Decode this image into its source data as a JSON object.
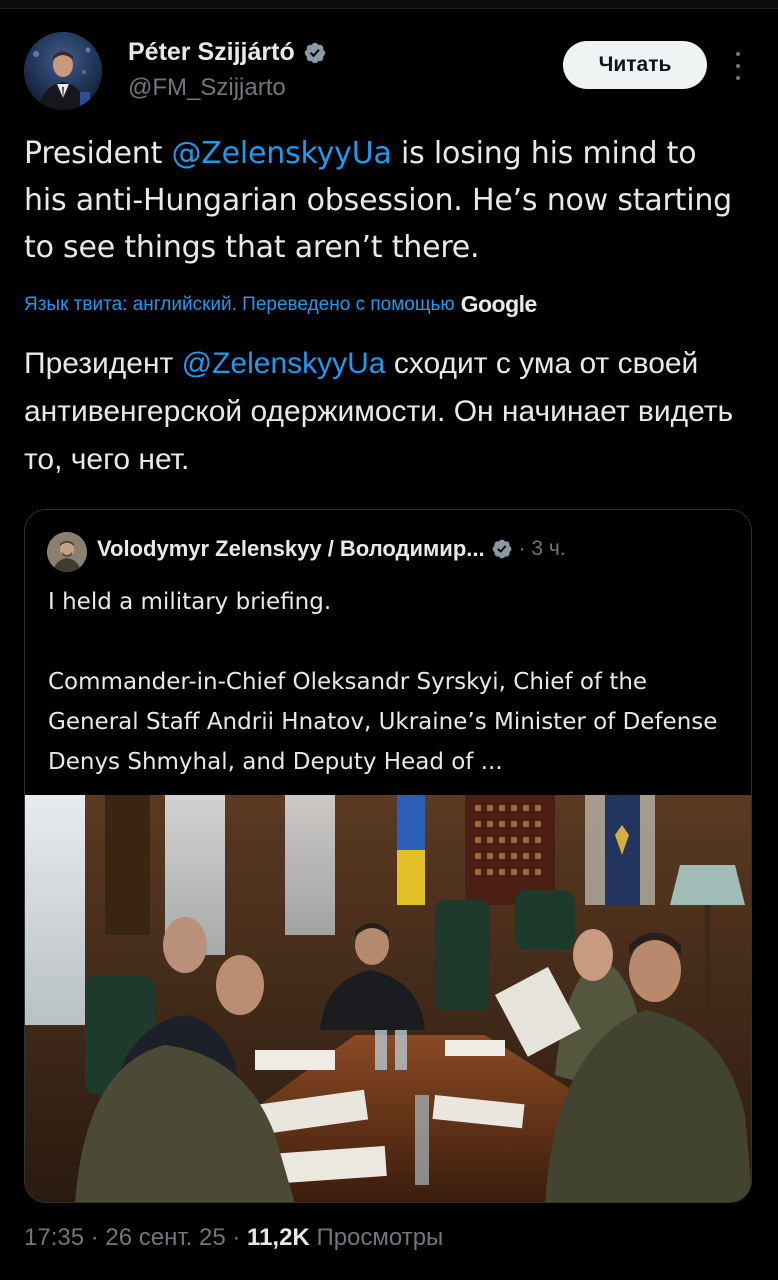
{
  "tweet": {
    "author": {
      "name": "Péter Szijjártó",
      "handle": "@FM_Szijjarto",
      "verified": true
    },
    "read_button_label": "Читать",
    "text": {
      "part1": "President ",
      "mention": "@ZelenskyyUa",
      "part2": " is losing his mind to his anti-Hungarian obsession. He’s now starting to see things that aren’t there."
    },
    "translation_note": "Язык твита: английский. Переведено с помощью",
    "translation_provider": "Google",
    "translated_text": {
      "part1": "Президент ",
      "mention": "@ZelenskyyUa",
      "part2": " сходит с ума от своей антивенгерской одержимости. Он начинает видеть то, чего нет."
    },
    "footer": {
      "time": "17:35",
      "date": "26 сент. 25",
      "views": "11,2K",
      "views_label": "Просмотры",
      "separator": " · "
    }
  },
  "quoted_tweet": {
    "author_name": "Volodymyr Zelenskyy / Володимир...",
    "verified": true,
    "meta": "· 3 ч.",
    "paragraph1": "I held a military briefing.",
    "paragraph2": "Commander-in-Chief Oleksandr Syrskyi, Chief of the General Staff Andrii Hnatov, Ukraine’s Minister of Defense Denys Shmyhal, and Deputy Head of ..."
  },
  "colors": {
    "background": "#000000",
    "text": "#e7e9ea",
    "secondary": "#71767b",
    "accent": "#1d9bf0",
    "border": "#2f3336",
    "button_bg": "#eff3f4"
  },
  "icons": {
    "verified": "verified-badge-icon",
    "more": "more-options-icon"
  }
}
